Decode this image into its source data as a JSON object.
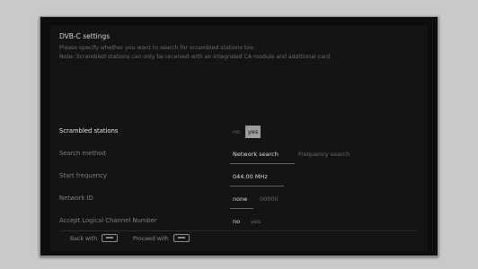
{
  "dialog": {
    "title": "DVB-C settings",
    "line1": "Please specify whether you want to search for scrambled stations too.",
    "line2": "Note: Scrambled stations can only be received with an integrated CA module and additional card."
  },
  "rows": {
    "scrambled": {
      "label": "Scrambled stations",
      "options": [
        "no",
        "yes"
      ],
      "selected": "yes"
    },
    "search_method": {
      "label": "Search method",
      "options": [
        "Network search",
        "Frequency search"
      ],
      "selected": "Network search"
    },
    "start_frequency": {
      "label": "Start frequency",
      "value": "044.00",
      "unit": "MHz"
    },
    "network_id": {
      "label": "Network ID",
      "options": [
        "none",
        "00000"
      ],
      "selected": "none"
    },
    "lcn": {
      "label": "Accept Logical Channel Number",
      "options": [
        "no",
        "yes"
      ],
      "selected": "no"
    }
  },
  "footer": {
    "back_label": "Back with",
    "proceed_label": "Proceed with"
  },
  "colors": {
    "highlight": "#9b9b9b",
    "background": "#141414",
    "text": "#dcdcdc"
  }
}
